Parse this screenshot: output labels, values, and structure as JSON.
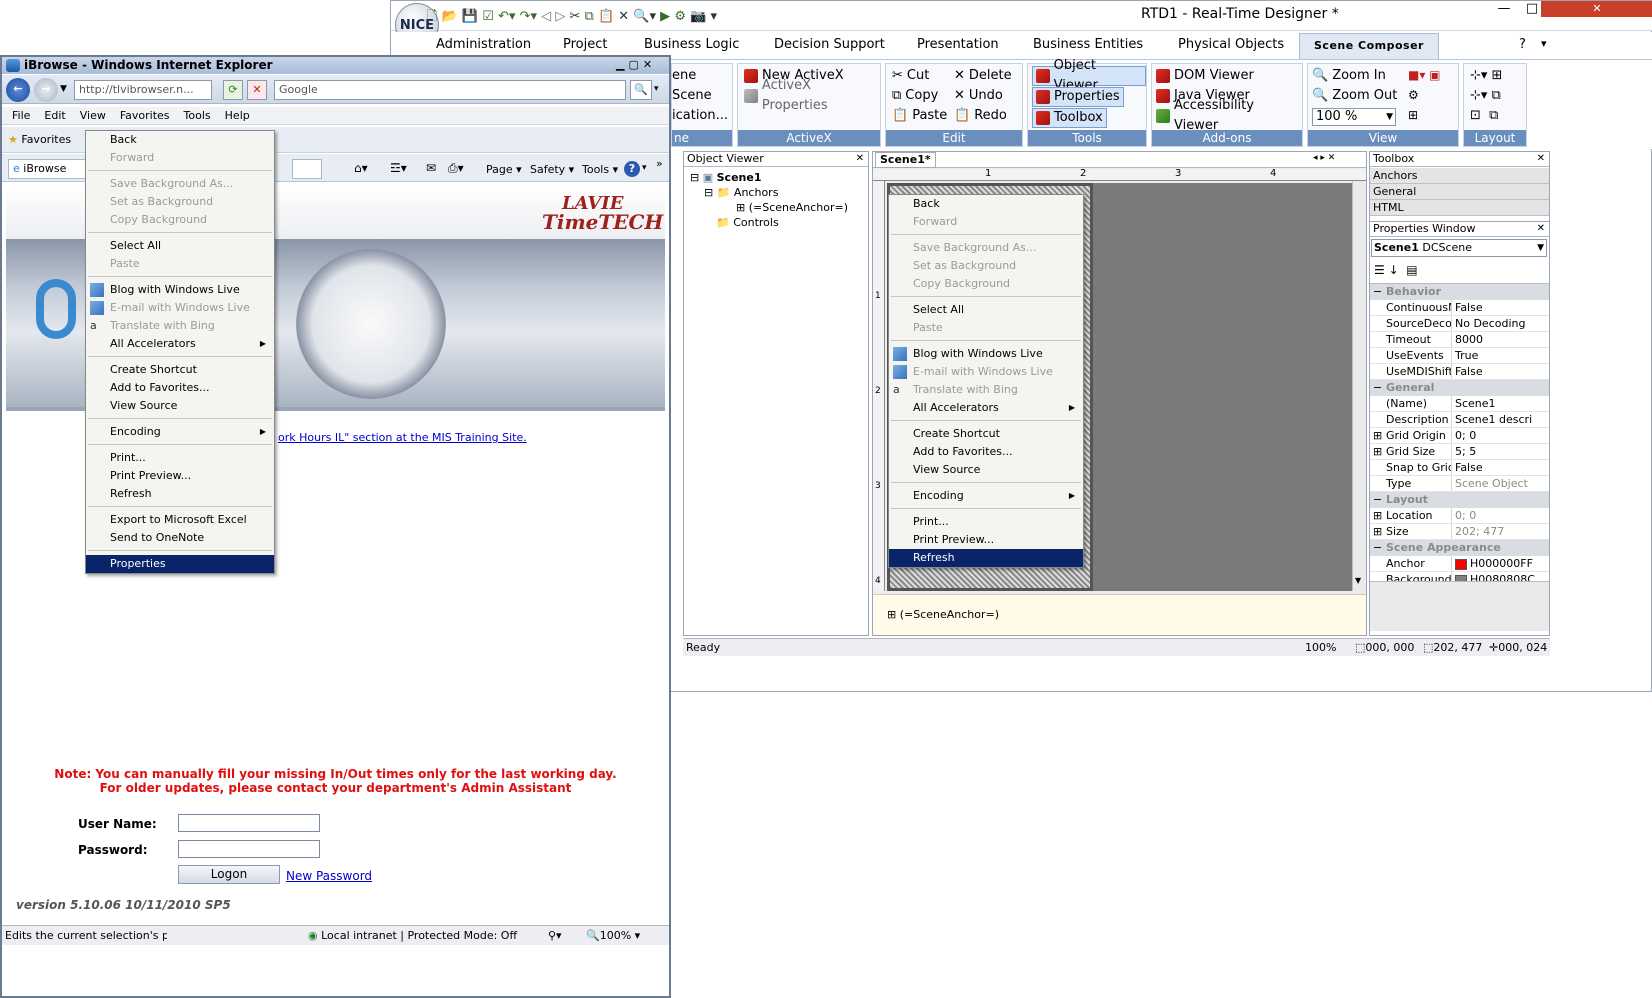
{
  "app": {
    "logo": "NICE",
    "title": "RTD1 - Real-Time Designer *",
    "win_min": "—",
    "win_max": "□",
    "win_close": "✕",
    "tabs": [
      "Administration",
      "Project",
      "Business Logic",
      "Decision Support",
      "Presentation",
      "Business Entities",
      "Physical Objects"
    ],
    "active_tab": "Scene Composer",
    "ribbon": {
      "scene_group": {
        "items": [
          "ene",
          "Scene",
          "ication..."
        ],
        "label": "ne"
      },
      "activex": {
        "items": [
          "New ActiveX",
          "ActiveX Properties"
        ],
        "label": "ActiveX"
      },
      "edit": {
        "col1": [
          "Cut",
          "Copy",
          "Paste"
        ],
        "col2": [
          "Delete",
          "Undo",
          "Redo"
        ],
        "label": "Edit"
      },
      "tools": {
        "items": [
          "Object Viewer",
          "Properties",
          "Toolbox"
        ],
        "label": "Tools"
      },
      "addons": {
        "items": [
          "DOM Viewer",
          "Java Viewer",
          "Accessibility Viewer"
        ],
        "label": "Add-ons"
      },
      "view": {
        "items": [
          "Zoom In",
          "Zoom Out"
        ],
        "zoom": "100 %",
        "label": "View"
      },
      "layout": {
        "label": "Layout"
      }
    },
    "object_viewer": {
      "title": "Object Viewer",
      "tree": [
        "Scene1",
        "Anchors",
        "(=SceneAnchor=)",
        "Controls"
      ]
    },
    "scene_tab": "Scene1*",
    "ruler": [
      "1",
      "2",
      "3",
      "4"
    ],
    "ruler_v": [
      "1",
      "2",
      "3",
      "4"
    ],
    "bottom_anchor": "(=SceneAnchor=)",
    "status": {
      "text": "Ready",
      "zoom": "100%",
      "pos": "000, 000",
      "size": "202, 477",
      "offset": "000, 024"
    },
    "toolbox": {
      "title": "Toolbox",
      "items": [
        "Anchors",
        "General",
        "HTML"
      ]
    },
    "properties": {
      "title": "Properties Window",
      "object": "Scene1",
      "object_type": "DCScene",
      "categories": [
        {
          "name": "Behavior",
          "rows": [
            [
              "ContinuousMode",
              "False"
            ],
            [
              "SourceDecoding",
              "No Decoding"
            ],
            [
              "Timeout",
              "8000"
            ],
            [
              "UseEvents",
              "True"
            ],
            [
              "UseMDIShift",
              "False"
            ]
          ]
        },
        {
          "name": "General",
          "rows": [
            [
              "(Name)",
              "Scene1"
            ],
            [
              "Description",
              "Scene1 descri"
            ],
            [
              "Grid Origin",
              "0; 0"
            ],
            [
              "Grid Size",
              "5; 5"
            ],
            [
              "Snap to Grid",
              "False"
            ],
            [
              "Type",
              "Scene Object"
            ]
          ]
        },
        {
          "name": "Layout",
          "rows": [
            [
              "Location",
              "0; 0"
            ],
            [
              "Size",
              "202; 477"
            ]
          ]
        },
        {
          "name": "Scene Appearance",
          "rows": [
            [
              "Anchor",
              "H000000FF"
            ],
            [
              "Background",
              "H0080808C"
            ]
          ]
        }
      ]
    },
    "context_menu": [
      {
        "t": "Back"
      },
      {
        "t": "Forward",
        "d": true
      },
      {
        "sep": true
      },
      {
        "t": "Save Background As...",
        "d": true
      },
      {
        "t": "Set as Background",
        "d": true
      },
      {
        "t": "Copy Background",
        "d": true
      },
      {
        "sep": true
      },
      {
        "t": "Select All"
      },
      {
        "t": "Paste",
        "d": true
      },
      {
        "sep": true
      },
      {
        "t": "Blog with Windows Live",
        "i": "blog"
      },
      {
        "t": "E-mail with Windows Live",
        "d": true,
        "i": "mail"
      },
      {
        "t": "Translate with Bing",
        "d": true,
        "i": "tr"
      },
      {
        "t": "All Accelerators",
        "a": true
      },
      {
        "sep": true
      },
      {
        "t": "Create Shortcut"
      },
      {
        "t": "Add to Favorites..."
      },
      {
        "t": "View Source"
      },
      {
        "sep": true
      },
      {
        "t": "Encoding",
        "a": true
      },
      {
        "sep": true
      },
      {
        "t": "Print..."
      },
      {
        "t": "Print Preview..."
      },
      {
        "t": "Refresh",
        "h": true
      }
    ]
  },
  "ie": {
    "title": "iBrowse - Windows Internet Explorer",
    "address": "http://tlvibrowser.n...",
    "search": "Google",
    "menu": [
      "File",
      "Edit",
      "View",
      "Favorites",
      "Tools",
      "Help"
    ],
    "favorites": "Favorites",
    "page_tab": "iBrowse",
    "cmdbar": [
      "Page ▾",
      "Safety ▾",
      "Tools ▾"
    ],
    "logo_top": "LAVIE",
    "logo_bottom": "TimeTECH",
    "link": "ork Hours IL\" section at the MIS Training Site.",
    "note1": "Note: You can manually fill your missing In/Out times only for the last working day.",
    "note2": "For older updates, please contact your department's Admin Assistant",
    "user_label": "User Name:",
    "pass_label": "Password:",
    "logon": "Logon",
    "new_password": "New Password",
    "version": "version 5.10.06 10/11/2010 SP5",
    "status": "Edits the current selection's propert",
    "zone": "Local intranet | Protected Mode: Off",
    "zoom": "100%",
    "context_menu": [
      {
        "t": "Back"
      },
      {
        "t": "Forward",
        "d": true
      },
      {
        "sep": true
      },
      {
        "t": "Save Background As...",
        "d": true
      },
      {
        "t": "Set as Background",
        "d": true
      },
      {
        "t": "Copy Background",
        "d": true
      },
      {
        "sep": true
      },
      {
        "t": "Select All"
      },
      {
        "t": "Paste",
        "d": true
      },
      {
        "sep": true
      },
      {
        "t": "Blog with Windows Live",
        "i": "blog"
      },
      {
        "t": "E-mail with Windows Live",
        "d": true,
        "i": "mail"
      },
      {
        "t": "Translate with Bing",
        "d": true,
        "i": "tr"
      },
      {
        "t": "All Accelerators",
        "a": true
      },
      {
        "sep": true
      },
      {
        "t": "Create Shortcut"
      },
      {
        "t": "Add to Favorites..."
      },
      {
        "t": "View Source"
      },
      {
        "sep": true
      },
      {
        "t": "Encoding",
        "a": true
      },
      {
        "sep": true
      },
      {
        "t": "Print..."
      },
      {
        "t": "Print Preview..."
      },
      {
        "t": "Refresh"
      },
      {
        "sep": true
      },
      {
        "t": "Export to Microsoft Excel"
      },
      {
        "t": "Send to OneNote"
      },
      {
        "sep": true
      },
      {
        "t": "Properties",
        "h": true
      }
    ]
  }
}
